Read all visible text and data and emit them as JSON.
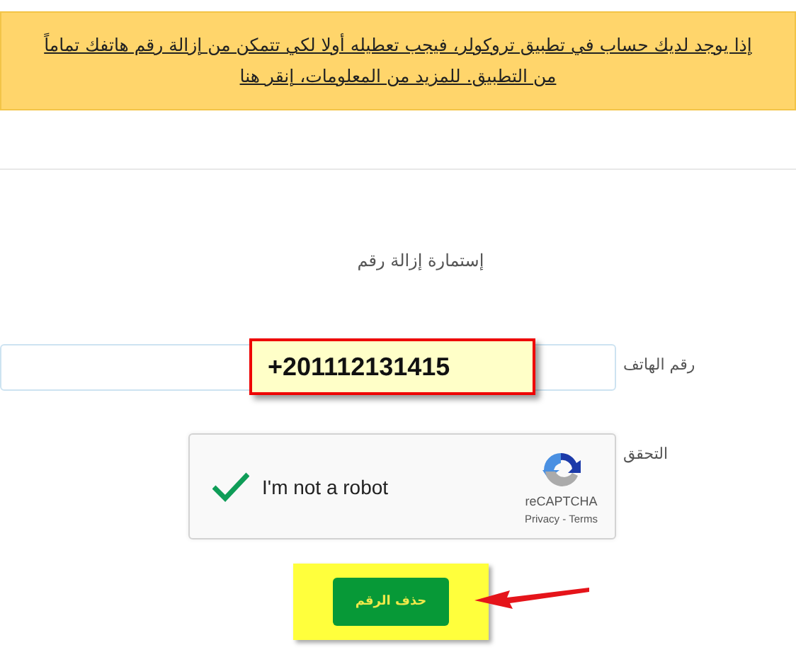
{
  "notice": {
    "text": "إذا يوجد لديك حساب في تطبيق تروكولر، فيجب تعطيله أولا لكي تتمكن من إزالة رقم هاتفك تماماً من التطبيق. للمزيد من المعلومات، إنقر هنا"
  },
  "form": {
    "title": "إستمارة إزالة رقم",
    "phone": {
      "label": "رقم الهاتف"
    },
    "verification": {
      "label": "التحقق",
      "captcha": {
        "label": "I'm not a robot",
        "checked": true,
        "brand": "reCAPTCHA",
        "links": "Privacy - Terms"
      }
    },
    "submit": {
      "label": "حذف الرقم"
    }
  },
  "annotation": {
    "text": "+201112131415"
  }
}
